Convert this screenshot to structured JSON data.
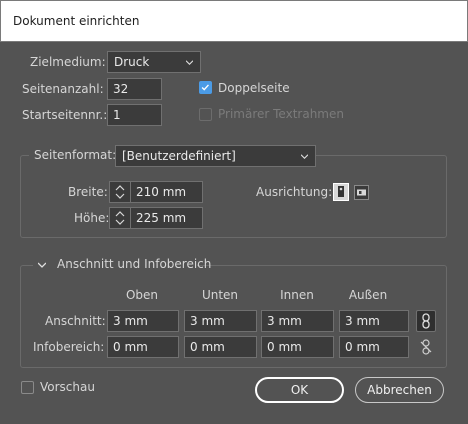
{
  "window": {
    "title": "Dokument einrichten"
  },
  "setup": {
    "target_label": "Zielmedium:",
    "target_value": "Druck",
    "pages_label": "Seitenanzahl:",
    "pages_value": "32",
    "start_label": "Startseitennr.:",
    "start_value": "1",
    "facing_label": "Doppelseite",
    "facing_checked": true,
    "primary_frame_label": "Primärer Textrahmen",
    "primary_frame_checked": false
  },
  "page_size": {
    "label": "Seitenformat:",
    "value": "[Benutzerdefiniert]",
    "width_label": "Breite:",
    "width_value": "210 mm",
    "height_label": "Höhe:",
    "height_value": "225 mm",
    "orientation_label": "Ausrichtung:"
  },
  "bleed_slug": {
    "header": "Anschnitt und Infobereich",
    "columns": [
      "Oben",
      "Unten",
      "Innen",
      "Außen"
    ],
    "bleed_label": "Anschnitt:",
    "bleed_values": [
      "3 mm",
      "3 mm",
      "3 mm",
      "3 mm"
    ],
    "slug_label": "Infobereich:",
    "slug_values": [
      "0 mm",
      "0 mm",
      "0 mm",
      "0 mm"
    ]
  },
  "footer": {
    "preview_label": "Vorschau",
    "ok_label": "OK",
    "cancel_label": "Abbrechen"
  },
  "colors": {
    "accent": "#4b9be6",
    "background": "#535353",
    "field": "#3b3b3b"
  }
}
